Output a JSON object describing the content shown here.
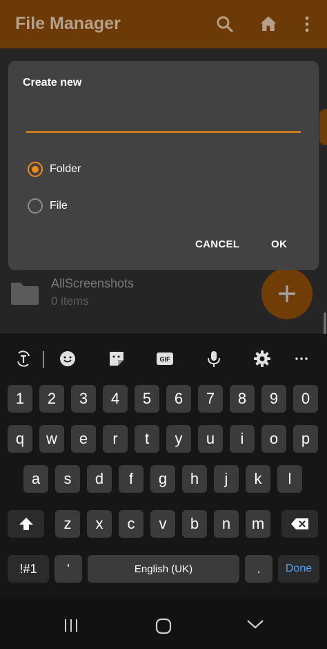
{
  "app": {
    "title": "File Manager",
    "accent_color": "#f08a12",
    "icons": [
      "search-icon",
      "home-icon",
      "more-vert-icon"
    ]
  },
  "list": {
    "items": [
      {
        "name": "AllScreenshots",
        "subtitle": "0 items",
        "icon": "folder-icon"
      }
    ],
    "fab_icon": "plus-icon"
  },
  "dialog": {
    "title": "Create new",
    "input_value": "",
    "options": [
      {
        "label": "Folder",
        "checked": true
      },
      {
        "label": "File",
        "checked": false
      }
    ],
    "cancel_label": "CANCEL",
    "ok_label": "OK"
  },
  "keyboard": {
    "toolbar_icons": [
      "text-convert-icon",
      "emoji-icon",
      "sticker-icon",
      "gif-icon",
      "microphone-icon",
      "settings-icon",
      "more-horiz-icon"
    ],
    "gif_label": "GIF",
    "row_numbers": [
      "1",
      "2",
      "3",
      "4",
      "5",
      "6",
      "7",
      "8",
      "9",
      "0"
    ],
    "row_top": [
      "q",
      "w",
      "e",
      "r",
      "t",
      "y",
      "u",
      "i",
      "o",
      "p"
    ],
    "row_middle": [
      "a",
      "s",
      "d",
      "f",
      "g",
      "h",
      "j",
      "k",
      "l"
    ],
    "row_bottom": [
      "z",
      "x",
      "c",
      "v",
      "b",
      "n",
      "m"
    ],
    "symbols_label": "!#1",
    "apostrophe_label": "'",
    "space_label": "English (UK)",
    "period_label": ".",
    "done_label": "Done",
    "done_color": "#4aa3ff"
  },
  "navbar": {
    "icons": [
      "recents-icon",
      "home-circle-icon",
      "back-chevron-icon"
    ]
  }
}
